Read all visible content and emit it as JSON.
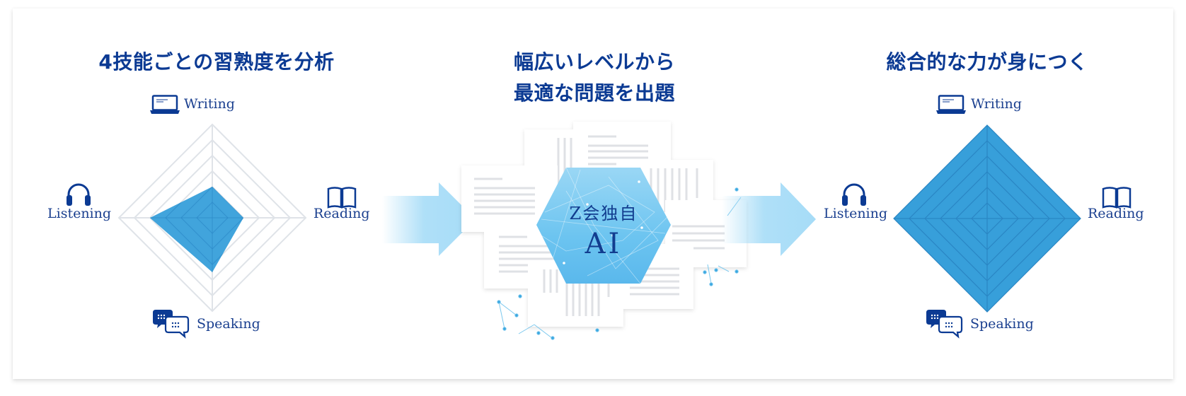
{
  "sections": {
    "left": {
      "title": "4技能ごとの習熟度を分析",
      "labels": {
        "writing": "Writing",
        "reading": "Reading",
        "speaking": "Speaking",
        "listening": "Listening"
      }
    },
    "middle": {
      "title_line1": "幅広いレベルから",
      "title_line2": "最適な問題を出題",
      "ai_badge_line1": "Z会独自",
      "ai_badge_line2": "AI"
    },
    "right": {
      "title": "総合的な力が身につく",
      "labels": {
        "writing": "Writing",
        "reading": "Reading",
        "speaking": "Speaking",
        "listening": "Listening"
      }
    }
  },
  "icons": {
    "writing": "laptop-icon",
    "reading": "open-book-icon",
    "speaking": "speech-bubbles-icon",
    "listening": "headphones-icon",
    "flow": "right-arrow-icon"
  },
  "colors": {
    "title": "#0b3a93",
    "radar_fill": "#379fda",
    "grid": "#dfe3e8",
    "arrow": "#a6dcf7",
    "hexagon": "#6cc4f0"
  },
  "chart_data": [
    {
      "type": "radar",
      "title": "4技能ごとの習熟度を分析",
      "axes": [
        "Writing",
        "Reading",
        "Speaking",
        "Listening"
      ],
      "levels": 6,
      "range": [
        0,
        6
      ],
      "values": [
        2,
        2,
        3.5,
        4
      ]
    },
    {
      "type": "radar",
      "title": "総合的な力が身につく",
      "axes": [
        "Writing",
        "Reading",
        "Speaking",
        "Listening"
      ],
      "levels": 6,
      "range": [
        0,
        6
      ],
      "values": [
        6,
        6,
        6,
        6
      ]
    }
  ]
}
